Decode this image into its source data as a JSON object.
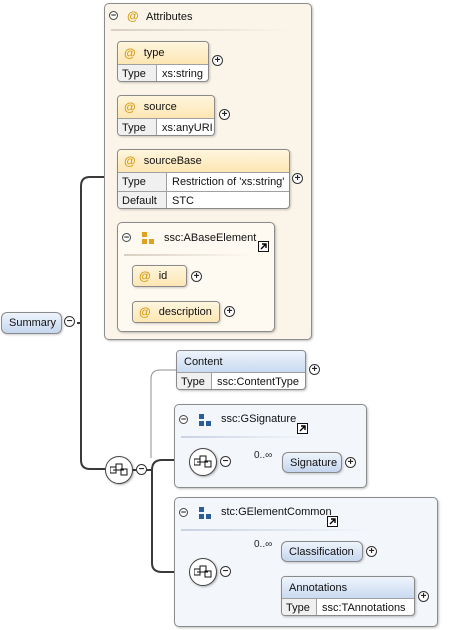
{
  "root": {
    "label": "Summary"
  },
  "attributes_group": {
    "title": "Attributes",
    "items": [
      {
        "name": "type",
        "type_key": "Type",
        "type_value": "xs:string"
      },
      {
        "name": "source",
        "type_key": "Type",
        "type_value": "xs:anyURI"
      },
      {
        "name": "sourceBase",
        "type_key": "Type",
        "type_value": "Restriction of 'xs:string'",
        "default_key": "Default",
        "default_value": "STC"
      }
    ],
    "base_group": {
      "title": "ssc:ABaseElement",
      "items": [
        {
          "name": "id"
        },
        {
          "name": "description"
        }
      ]
    }
  },
  "content": {
    "name": "Content",
    "type_key": "Type",
    "type_value": "ssc:ContentType"
  },
  "signature_group": {
    "title": "ssc:GSignature",
    "occurrence": "0..∞",
    "element": "Signature"
  },
  "common_group": {
    "title": "stc:GElementCommon",
    "occurrence": "0..∞",
    "classification": "Classification",
    "annotations": {
      "name": "Annotations",
      "type_key": "Type",
      "type_value": "ssc:TAnnotations"
    }
  },
  "icons": {
    "at": "@",
    "collapse": "−",
    "expand": "+"
  }
}
